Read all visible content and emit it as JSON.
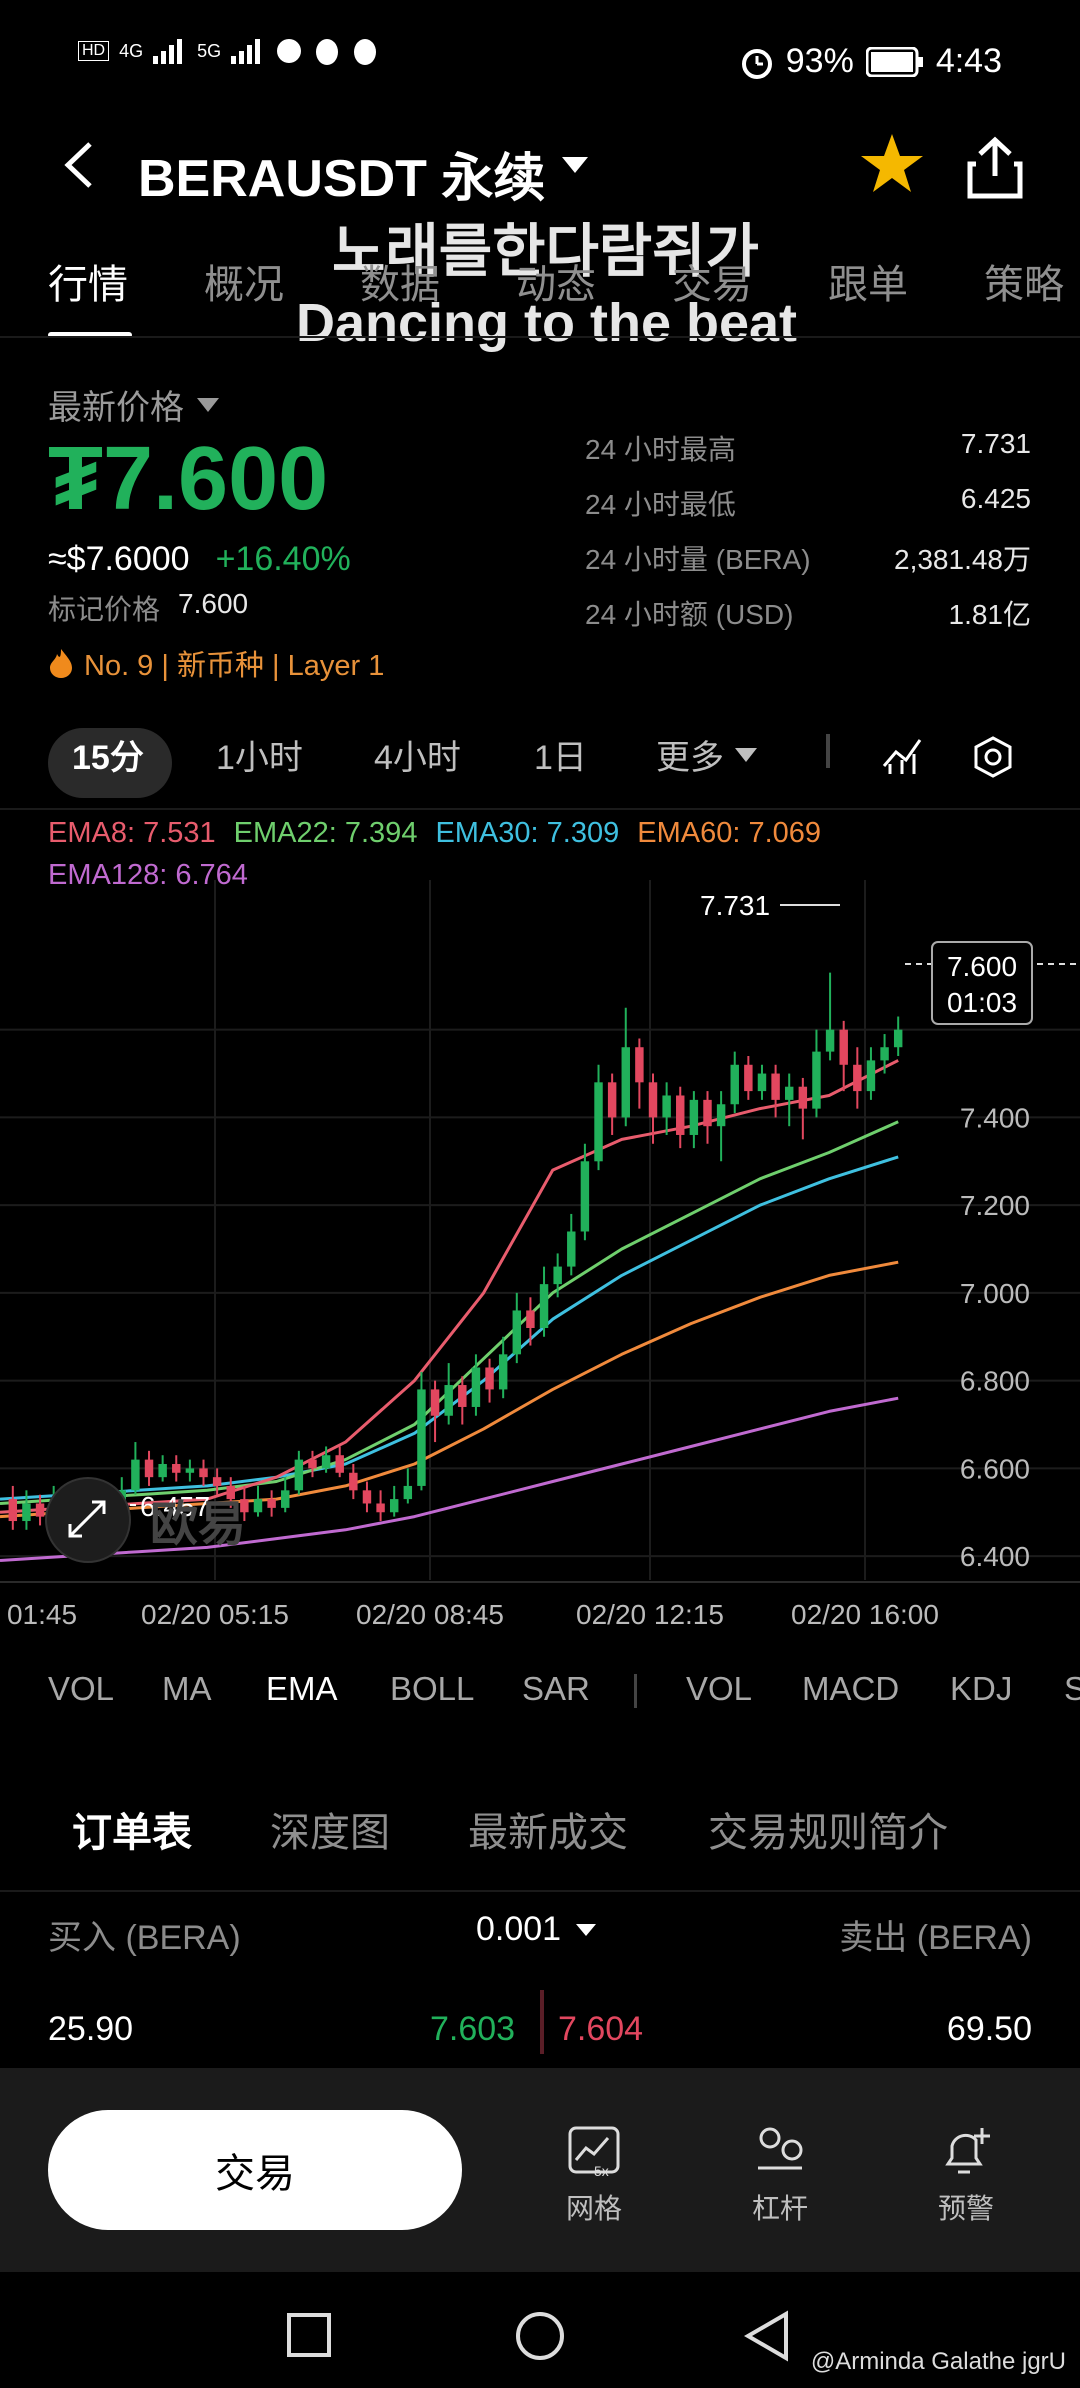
{
  "status_bar": {
    "left_indicators": "HD1 HD2 4G 5G",
    "battery": "93%",
    "time": "4:43"
  },
  "header": {
    "title": "BERAUSDT 永续"
  },
  "overlay": {
    "line1": "노래를한다람쥐가",
    "line2": "Dancing to the beat"
  },
  "tabs": [
    "行情",
    "概况",
    "数据",
    "动态",
    "交易",
    "跟单",
    "策略"
  ],
  "price_panel": {
    "label": "最新价格",
    "price": "₮7.600",
    "usd_price": "≈$7.6000",
    "change": "+16.40%",
    "mark_label": "标记价格",
    "mark_value": "7.600",
    "tags": "No. 9 | 新币种 | Layer 1",
    "stats": [
      {
        "k": "24 小时最高",
        "v": "7.731"
      },
      {
        "k": "24 小时最低",
        "v": "6.425"
      },
      {
        "k": "24 小时量 (BERA)",
        "v": "2,381.48万"
      },
      {
        "k": "24 小时额 (USD)",
        "v": "1.81亿"
      }
    ]
  },
  "timeframes": [
    "15分",
    "1小时",
    "4小时",
    "1日",
    "更多"
  ],
  "ema_legend": {
    "ema8": "EMA8: 7.531",
    "ema22": "EMA22: 7.394",
    "ema30": "EMA30: 7.309",
    "ema60": "EMA60: 7.069",
    "ema128": "EMA128: 6.764"
  },
  "colors": {
    "up": "#21b15b",
    "down": "#e2475f",
    "ema8": "#e85c6d",
    "ema22": "#6fcf6d",
    "ema30": "#3fc0e0",
    "ema60": "#f08a3c",
    "ema128": "#c06ad0"
  },
  "chart_data": {
    "type": "candlestick",
    "y_ticks": [
      "7.400",
      "7.200",
      "7.000",
      "6.800",
      "6.600",
      "6.400"
    ],
    "x_ticks": [
      "01:45",
      "02/20 05:15",
      "02/20 08:45",
      "02/20 12:15",
      "02/20 16:00"
    ],
    "high_label": "7.731",
    "low_label": "6.457",
    "current_price": "7.600",
    "countdown": "01:03",
    "ylim": [
      6.3,
      7.85
    ],
    "candles": [
      [
        6.53,
        6.48,
        6.56,
        6.46
      ],
      [
        6.48,
        6.52,
        6.55,
        6.46
      ],
      [
        6.52,
        6.49,
        6.54,
        6.47
      ],
      [
        6.49,
        6.53,
        6.56,
        6.47
      ],
      [
        6.53,
        6.5,
        6.55,
        6.48
      ],
      [
        6.5,
        6.48,
        6.52,
        6.46
      ],
      [
        6.48,
        6.51,
        6.54,
        6.47
      ],
      [
        6.51,
        6.49,
        6.53,
        6.47
      ],
      [
        6.49,
        6.55,
        6.58,
        6.48
      ],
      [
        6.55,
        6.62,
        6.66,
        6.54
      ],
      [
        6.62,
        6.58,
        6.64,
        6.56
      ],
      [
        6.58,
        6.61,
        6.63,
        6.57
      ],
      [
        6.61,
        6.59,
        6.63,
        6.57
      ],
      [
        6.59,
        6.6,
        6.62,
        6.57
      ],
      [
        6.6,
        6.58,
        6.62,
        6.56
      ],
      [
        6.58,
        6.56,
        6.6,
        6.54
      ],
      [
        6.56,
        6.53,
        6.58,
        6.51
      ],
      [
        6.53,
        6.5,
        6.56,
        6.48
      ],
      [
        6.5,
        6.53,
        6.56,
        6.49
      ],
      [
        6.53,
        6.51,
        6.55,
        6.49
      ],
      [
        6.51,
        6.55,
        6.58,
        6.5
      ],
      [
        6.55,
        6.62,
        6.64,
        6.54
      ],
      [
        6.62,
        6.6,
        6.64,
        6.58
      ],
      [
        6.6,
        6.63,
        6.65,
        6.59
      ],
      [
        6.63,
        6.59,
        6.65,
        6.58
      ],
      [
        6.59,
        6.55,
        6.61,
        6.53
      ],
      [
        6.55,
        6.52,
        6.57,
        6.5
      ],
      [
        6.52,
        6.5,
        6.55,
        6.48
      ],
      [
        6.5,
        6.53,
        6.56,
        6.49
      ],
      [
        6.53,
        6.56,
        6.6,
        6.52
      ],
      [
        6.56,
        6.78,
        6.82,
        6.55
      ],
      [
        6.78,
        6.72,
        6.8,
        6.66
      ],
      [
        6.72,
        6.79,
        6.84,
        6.7
      ],
      [
        6.79,
        6.74,
        6.81,
        6.7
      ],
      [
        6.74,
        6.83,
        6.86,
        6.72
      ],
      [
        6.83,
        6.78,
        6.85,
        6.75
      ],
      [
        6.78,
        6.86,
        6.9,
        6.76
      ],
      [
        6.86,
        6.96,
        7.0,
        6.84
      ],
      [
        6.96,
        6.92,
        6.99,
        6.88
      ],
      [
        6.92,
        7.02,
        7.06,
        6.9
      ],
      [
        7.02,
        7.06,
        7.09,
        6.99
      ],
      [
        7.06,
        7.14,
        7.18,
        7.04
      ],
      [
        7.14,
        7.3,
        7.34,
        7.12
      ],
      [
        7.3,
        7.48,
        7.52,
        7.28
      ],
      [
        7.48,
        7.4,
        7.5,
        7.36
      ],
      [
        7.4,
        7.56,
        7.65,
        7.38
      ],
      [
        7.56,
        7.48,
        7.58,
        7.42
      ],
      [
        7.48,
        7.4,
        7.5,
        7.34
      ],
      [
        7.4,
        7.45,
        7.48,
        7.36
      ],
      [
        7.45,
        7.36,
        7.47,
        7.33
      ],
      [
        7.36,
        7.44,
        7.46,
        7.33
      ],
      [
        7.44,
        7.38,
        7.46,
        7.34
      ],
      [
        7.38,
        7.43,
        7.46,
        7.3
      ],
      [
        7.43,
        7.52,
        7.55,
        7.41
      ],
      [
        7.52,
        7.46,
        7.54,
        7.44
      ],
      [
        7.46,
        7.5,
        7.52,
        7.44
      ],
      [
        7.5,
        7.44,
        7.52,
        7.4
      ],
      [
        7.44,
        7.47,
        7.5,
        7.38
      ],
      [
        7.47,
        7.42,
        7.49,
        7.35
      ],
      [
        7.42,
        7.55,
        7.6,
        7.4
      ],
      [
        7.55,
        7.6,
        7.73,
        7.53
      ],
      [
        7.6,
        7.52,
        7.62,
        7.46
      ],
      [
        7.52,
        7.46,
        7.56,
        7.42
      ],
      [
        7.46,
        7.53,
        7.56,
        7.44
      ],
      [
        7.53,
        7.56,
        7.59,
        7.5
      ],
      [
        7.56,
        7.6,
        7.63,
        7.54
      ]
    ],
    "ema_series": {
      "ema8": [
        6.5,
        6.51,
        6.52,
        6.53,
        6.58,
        6.66,
        6.8,
        7.0,
        7.28,
        7.35,
        7.38,
        7.42,
        7.45,
        7.53
      ],
      "ema22": [
        6.52,
        6.53,
        6.54,
        6.55,
        6.57,
        6.62,
        6.7,
        6.85,
        7.0,
        7.1,
        7.18,
        7.26,
        7.32,
        7.39
      ],
      "ema30": [
        6.53,
        6.54,
        6.55,
        6.56,
        6.58,
        6.61,
        6.68,
        6.8,
        6.94,
        7.04,
        7.12,
        7.2,
        7.26,
        7.31
      ],
      "ema60": [
        6.49,
        6.5,
        6.51,
        6.52,
        6.53,
        6.56,
        6.61,
        6.69,
        6.78,
        6.86,
        6.93,
        6.99,
        7.04,
        7.07
      ],
      "ema128": [
        6.39,
        6.4,
        6.41,
        6.42,
        6.44,
        6.46,
        6.49,
        6.53,
        6.57,
        6.61,
        6.65,
        6.69,
        6.73,
        6.76
      ]
    }
  },
  "indicators": [
    "VOL",
    "MA",
    "EMA",
    "BOLL",
    "SAR",
    "VOL",
    "MACD",
    "KDJ",
    "S"
  ],
  "orderbook": {
    "tabs": [
      "订单表",
      "深度图",
      "最新成交",
      "交易规则简介"
    ],
    "buy_label": "买入 (BERA)",
    "step": "0.001",
    "sell_label": "卖出 (BERA)",
    "row": {
      "bid_qty": "25.90",
      "bid_price": "7.603",
      "ask_price": "7.604",
      "ask_qty": "69.50"
    }
  },
  "bottom_bar": {
    "trade": "交易",
    "grid": "网格",
    "lever": "杠杆",
    "alert": "预警"
  },
  "watermark": "@Arminda Galathe jgrU"
}
